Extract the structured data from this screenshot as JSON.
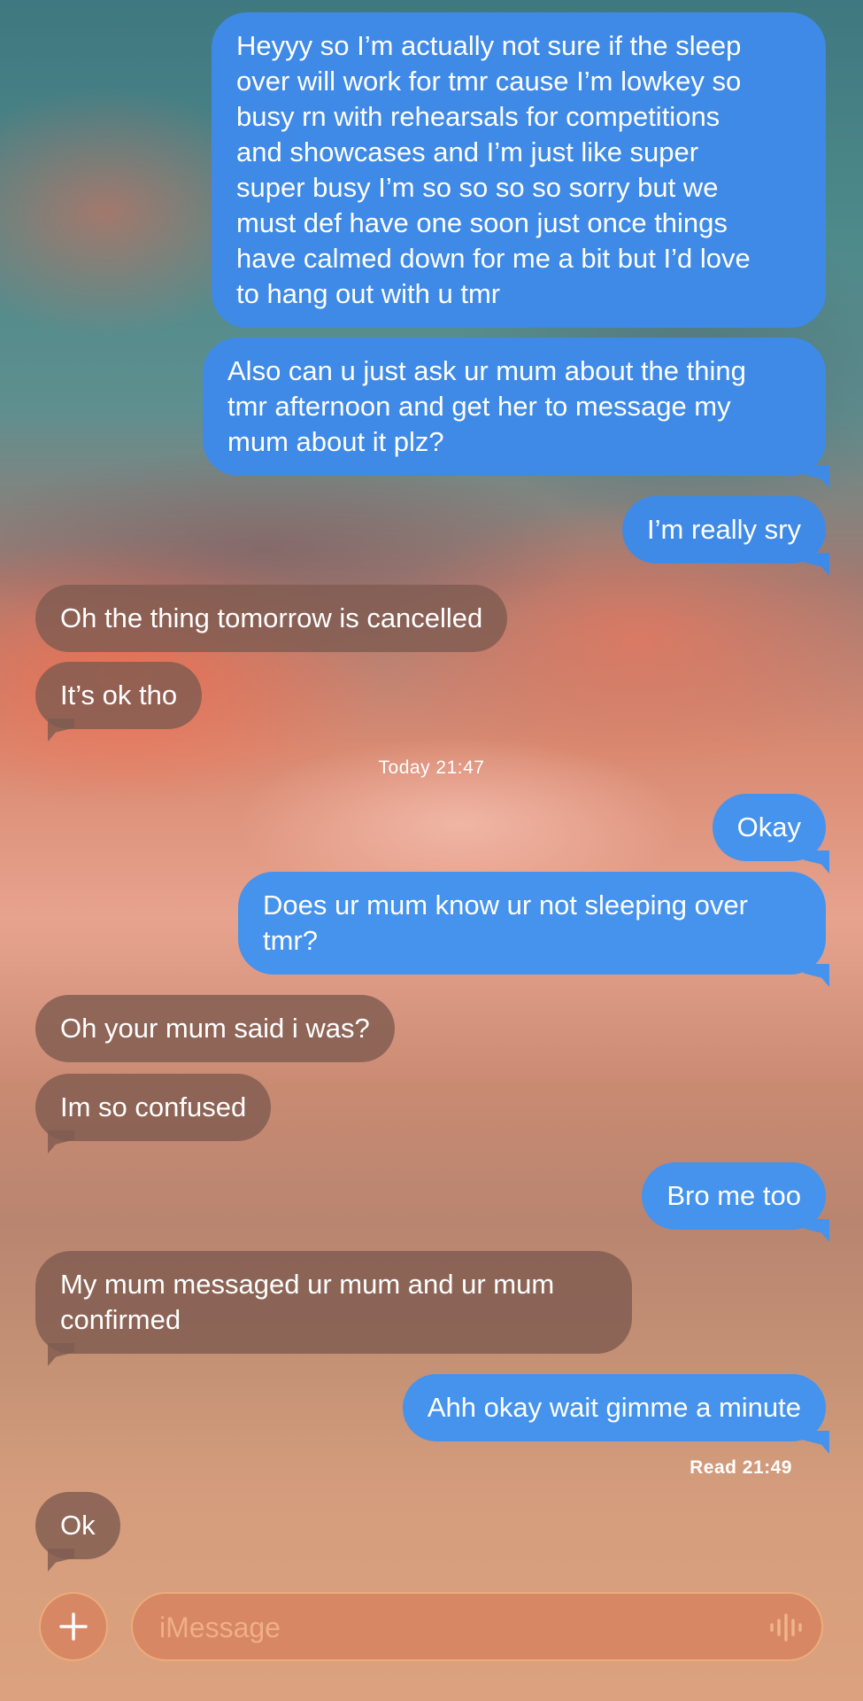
{
  "messages": [
    {
      "sender": "me",
      "text": "Heyyy so I’m actually not sure if the sleep\nover will work for tmr cause I’m lowkey so\nbusy rn with rehearsals for competitions\nand showcases and I’m just like super\nsuper busy I’m so so so so sorry but we\nmust def have one soon just once things\nhave calmed down for me a bit but I’d love\nto hang out with u tmr"
    },
    {
      "sender": "me",
      "text": "Also can u just ask ur mum about the thing\ntmr afternoon and get her to message my\nmum about it plz?"
    },
    {
      "sender": "me",
      "text": "I’m really sry"
    },
    {
      "sender": "them",
      "text": "Oh the thing tomorrow is cancelled"
    },
    {
      "sender": "them",
      "text": "It’s ok tho"
    },
    {
      "sender": "me",
      "text": "Okay"
    },
    {
      "sender": "me",
      "text": "Does ur mum know ur not sleeping over\ntmr?"
    },
    {
      "sender": "them",
      "text": "Oh your mum said i was?"
    },
    {
      "sender": "them",
      "text": "Im so confused"
    },
    {
      "sender": "me",
      "text": "Bro me too"
    },
    {
      "sender": "them",
      "text": "My mum messaged ur mum and ur mum\nconfirmed"
    },
    {
      "sender": "me",
      "text": "Ahh okay wait gimme a minute"
    },
    {
      "sender": "them",
      "text": "Ok"
    }
  ],
  "timestamp": "Today 21:47",
  "read_receipt": "Read 21:49",
  "compose": {
    "placeholder": "iMessage",
    "plus_icon": "plus-icon",
    "audio_icon": "waveform-icon"
  },
  "colors": {
    "outgoing_bubble": "#3f8ae6",
    "incoming_bubble": "#805c50",
    "compose_bg": "#d68460"
  }
}
